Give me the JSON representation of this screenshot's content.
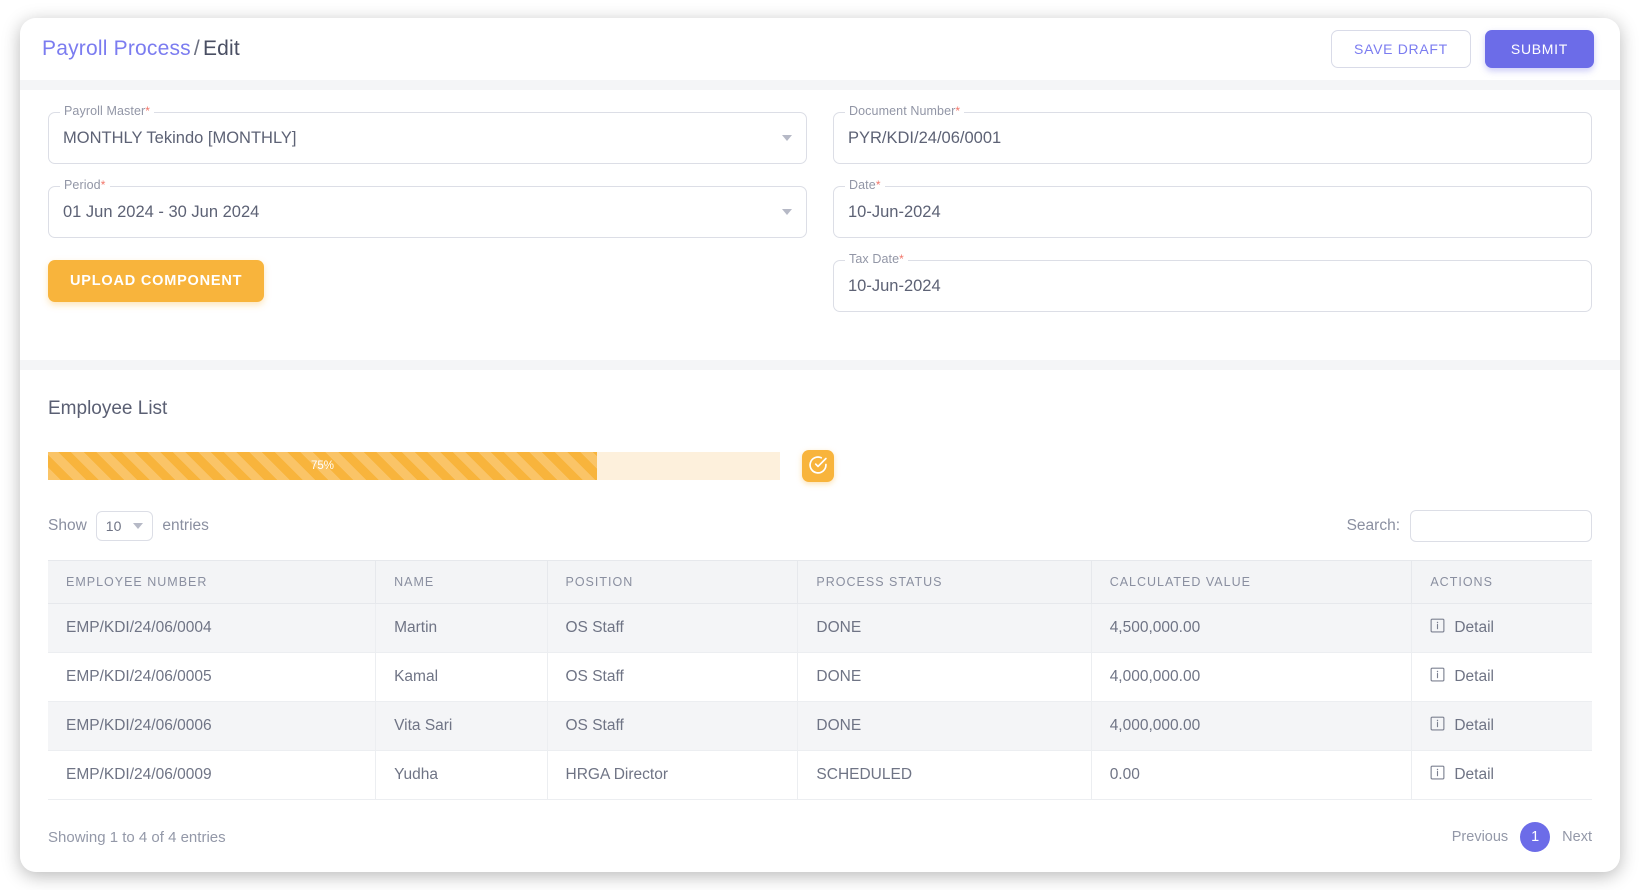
{
  "header": {
    "breadcrumb_link": "Payroll Process",
    "breadcrumb_sep": "/",
    "breadcrumb_current": "Edit",
    "save_draft_label": "SAVE DRAFT",
    "submit_label": "SUBMIT"
  },
  "form": {
    "payroll_master": {
      "label": "Payroll Master",
      "required": "*",
      "value": "MONTHLY Tekindo [MONTHLY]"
    },
    "period": {
      "label": "Period",
      "required": "*",
      "value": "01 Jun 2024 - 30 Jun 2024"
    },
    "upload_label": "UPLOAD COMPONENT",
    "document_number": {
      "label": "Document Number",
      "required": "*",
      "value": "PYR/KDI/24/06/0001"
    },
    "date": {
      "label": "Date",
      "required": "*",
      "value": "10-Jun-2024"
    },
    "tax_date": {
      "label": "Tax Date",
      "required": "*",
      "value": "10-Jun-2024"
    }
  },
  "employee_list": {
    "title": "Employee List",
    "progress": {
      "percent_label": "75%",
      "percent": 75
    },
    "confirm_icon": "check-circle-icon",
    "show_label": "Show",
    "entries_label": "entries",
    "page_size": "10",
    "search_label": "Search:",
    "search_value": "",
    "search_placeholder": "",
    "columns": [
      "EMPLOYEE NUMBER",
      "NAME",
      "POSITION",
      "PROCESS STATUS",
      "CALCULATED VALUE",
      "ACTIONS"
    ],
    "rows": [
      {
        "employee_number": "EMP/KDI/24/06/0004",
        "name": "Martin",
        "position": "OS Staff",
        "process_status": "DONE",
        "calculated_value": "4,500,000.00",
        "action": "Detail"
      },
      {
        "employee_number": "EMP/KDI/24/06/0005",
        "name": "Kamal",
        "position": "OS Staff",
        "process_status": "DONE",
        "calculated_value": "4,000,000.00",
        "action": "Detail"
      },
      {
        "employee_number": "EMP/KDI/24/06/0006",
        "name": "Vita Sari",
        "position": "OS Staff",
        "process_status": "DONE",
        "calculated_value": "4,000,000.00",
        "action": "Detail"
      },
      {
        "employee_number": "EMP/KDI/24/06/0009",
        "name": "Yudha",
        "position": "HRGA Director",
        "process_status": "SCHEDULED",
        "calculated_value": "0.00",
        "action": "Detail"
      }
    ],
    "footer_info": "Showing 1 to 4 of 4 entries",
    "pagination": {
      "previous": "Previous",
      "current_page": "1",
      "next": "Next"
    }
  },
  "colors": {
    "accent_purple": "#6c6ce8",
    "accent_orange": "#f8b43c",
    "required_red": "#f2766a",
    "text_muted": "#8a8fa0"
  }
}
